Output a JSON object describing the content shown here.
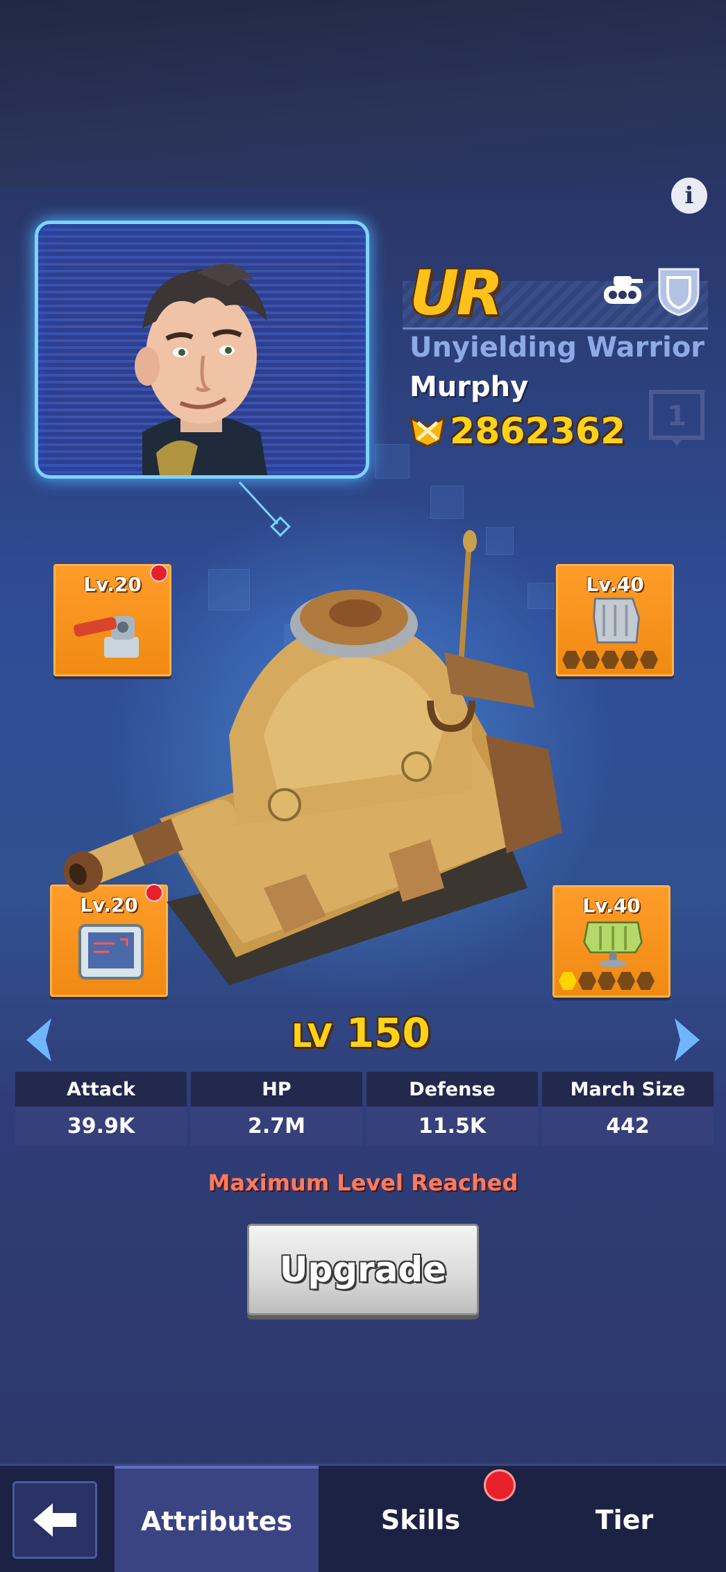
{
  "hero": {
    "rarity": "UR",
    "epithet": "Unyielding Warrior",
    "name": "Murphy",
    "power": "2862362"
  },
  "equipment": [
    {
      "slot": "top-left",
      "level": "Lv.20",
      "has_alert": true,
      "stars_filled": null,
      "stars_total": null,
      "icon": "cannon-icon"
    },
    {
      "slot": "top-right",
      "level": "Lv.40",
      "has_alert": false,
      "stars_filled": 0,
      "stars_total": 5,
      "icon": "armor-plate-icon"
    },
    {
      "slot": "bottom-left",
      "level": "Lv.20",
      "has_alert": true,
      "stars_filled": null,
      "stars_total": null,
      "icon": "radar-panel-icon"
    },
    {
      "slot": "bottom-right",
      "level": "Lv.40",
      "has_alert": false,
      "stars_filled": 1,
      "stars_total": 5,
      "icon": "armor-plate-icon"
    }
  ],
  "unit": {
    "level_prefix": "LV",
    "level_value": "150"
  },
  "stats": [
    {
      "label": "Attack",
      "value": "39.9K"
    },
    {
      "label": "HP",
      "value": "2.7M"
    },
    {
      "label": "Defense",
      "value": "11.5K"
    },
    {
      "label": "March Size",
      "value": "442"
    }
  ],
  "status_message": "Maximum Level Reached",
  "upgrade_label": "Upgrade",
  "tabs": [
    {
      "label": "Attributes",
      "active": true,
      "has_alert": false
    },
    {
      "label": "Skills",
      "active": false,
      "has_alert": true
    },
    {
      "label": "Tier",
      "active": false,
      "has_alert": false
    }
  ],
  "colors": {
    "rarity": "#ffc21a",
    "power": "#ffd21c",
    "status_message": "#ff7a5c",
    "equipment_slot": "#f08a12",
    "alert_dot": "#e8202a"
  }
}
